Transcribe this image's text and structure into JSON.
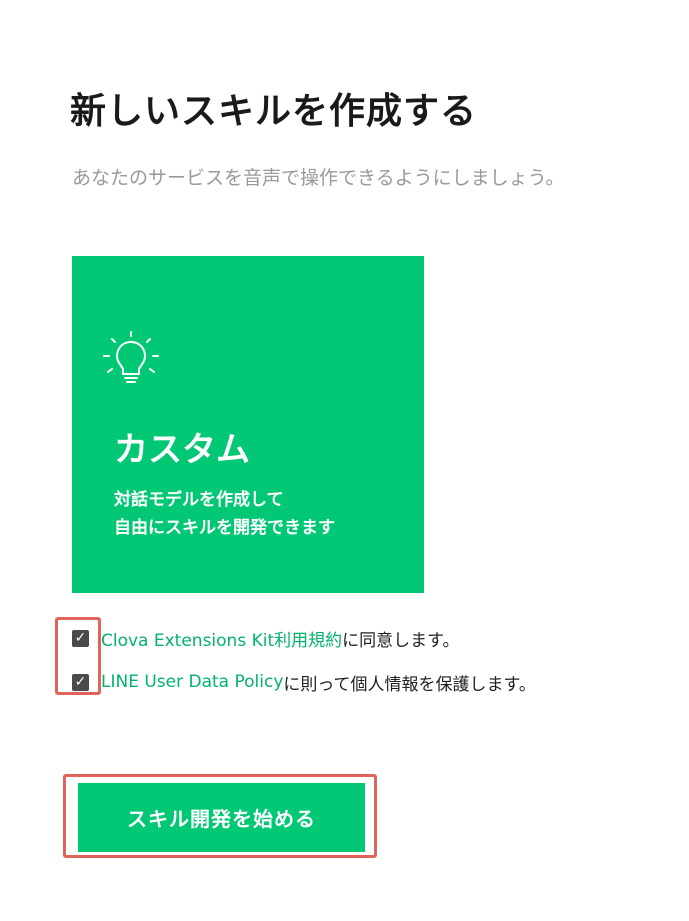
{
  "header": {
    "title": "新しいスキルを作成する",
    "subtitle": "あなたのサービスを音声で操作できるようにしましょう。"
  },
  "card": {
    "icon": "lightbulb-icon",
    "title": "カスタム",
    "desc_line1": "対話モデルを作成して",
    "desc_line2": "自由にスキルを開発できます",
    "color": "#02c875"
  },
  "agreements": [
    {
      "checked": true,
      "link_text": "Clova Extensions Kit利用規約",
      "suffix": "に同意します。"
    },
    {
      "checked": true,
      "link_text": "LINE User Data Policy",
      "suffix": "に則って個人情報を保護します。"
    }
  ],
  "checkbox_mark": "✓",
  "start_button": {
    "label": "スキル開発を始める"
  },
  "colors": {
    "accent": "#02c875",
    "link": "#02b36b",
    "highlight": "#e06457"
  }
}
